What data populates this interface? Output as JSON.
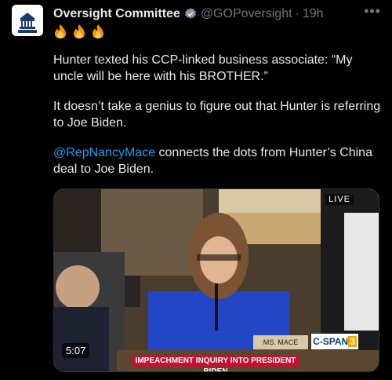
{
  "account": {
    "name": "Oversight Committee",
    "handle": "@GOPoversight",
    "time": "19h",
    "avatar_text": "OVERSIGHT"
  },
  "emojis": [
    "fire",
    "fire",
    "fire"
  ],
  "tweet": {
    "p1": "Hunter texted his CCP-linked business associate: “My uncle will be here with his BROTHER.”",
    "p2": "It doesn’t take a genius to figure out that Hunter is referring to Joe Biden.",
    "mention": "@RepNancyMace",
    "p3_rest": " connects the dots from Hunter’s China deal to Joe Biden."
  },
  "video": {
    "live_label": "LIVE",
    "duration": "5:07",
    "chyron": "IMPEACHMENT INQUIRY INTO PRESIDENT BIDEN",
    "placard": "MS. MACE",
    "network": "C-SPAN",
    "network_num": "3"
  }
}
